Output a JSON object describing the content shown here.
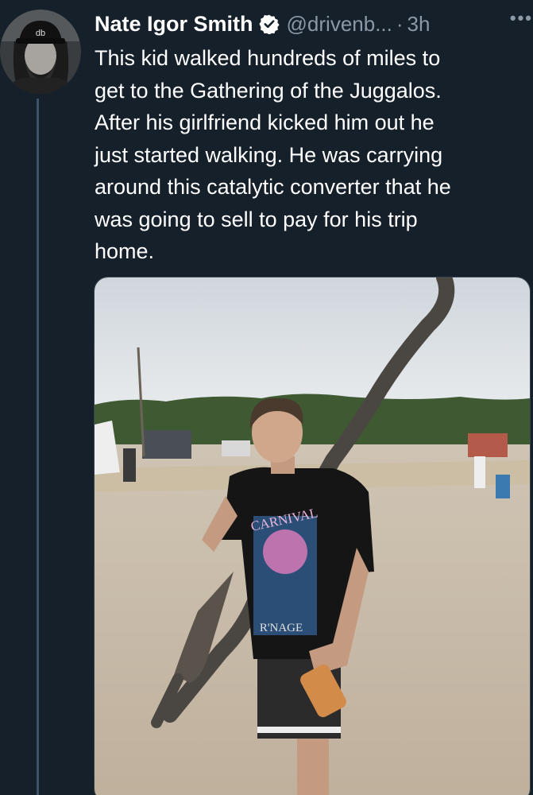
{
  "author": {
    "display_name": "Nate Igor Smith",
    "handle": "@drivenb...",
    "separator": "·",
    "timestamp": "3h",
    "verified": true,
    "avatar_icon": "user-avatar-cap-beard"
  },
  "tweet": {
    "text": "This kid walked hundreds of miles to\nget to the Gathering of the Juggalos.\nAfter his girlfriend kicked him out he\njust started walking. He was carrying\naround this catalytic converter that he\nwas going to sell to pay for his trip\nhome."
  },
  "menu": {
    "more_label": "•••"
  },
  "media": {
    "shirt_text_top": "CARNIVAL",
    "shirt_text_bottom": "R'NAGE"
  },
  "colors": {
    "background": "#15202b",
    "text_primary": "#ffffff",
    "text_secondary": "#8b98a5",
    "verified_badge": "#ffffff",
    "thread_line": "#3d5466"
  }
}
